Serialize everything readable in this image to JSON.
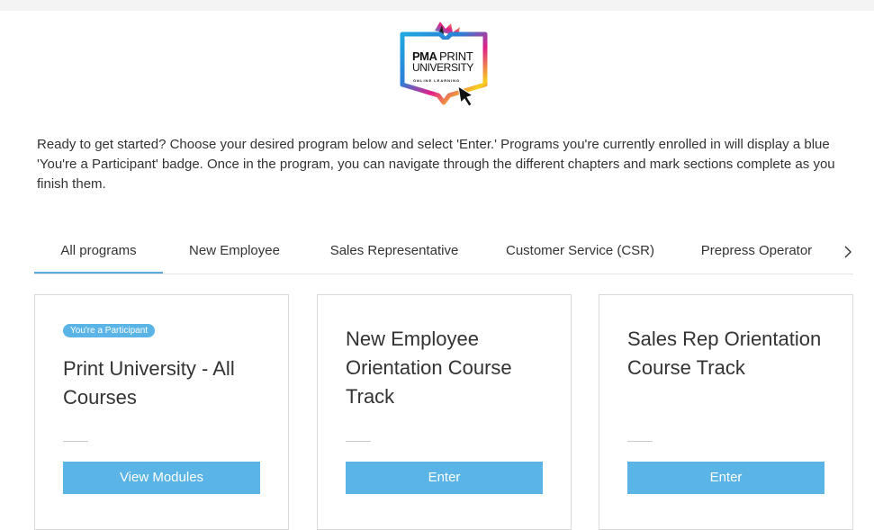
{
  "logo": {
    "line1_bold": "PMA",
    "line1_light": "PRINT",
    "line2": "UNIVERSITY",
    "line3": "ONLINE LEARNING",
    "alt": "PMA Print University Online Learning logo"
  },
  "intro_text": "Ready to get started? Choose your desired program below and select 'Enter.' Programs you're currently enrolled in will display a blue 'You're a Participant' badge. Once in the program, you can navigate through the different chapters and mark sections complete as you finish them.",
  "tabs": [
    {
      "label": "All programs",
      "active": true
    },
    {
      "label": "New Employee",
      "active": false
    },
    {
      "label": "Sales Representative",
      "active": false
    },
    {
      "label": "Customer Service (CSR)",
      "active": false
    },
    {
      "label": "Prepress Operator",
      "active": false
    }
  ],
  "tabs_next_icon": "chevron-right-icon",
  "cards": [
    {
      "badge": "You're a Participant",
      "title": "Print University - All Courses",
      "button": "View Modules"
    },
    {
      "badge": "",
      "title": "New Employee Orientation Course Track",
      "button": "Enter"
    },
    {
      "badge": "",
      "title": "Sales Rep Orientation Course Track",
      "button": "Enter"
    }
  ],
  "colors": {
    "accent": "#5ab4e5",
    "tab_underline": "#5aa9d8",
    "text": "#333333",
    "border": "#d9d9d9"
  }
}
